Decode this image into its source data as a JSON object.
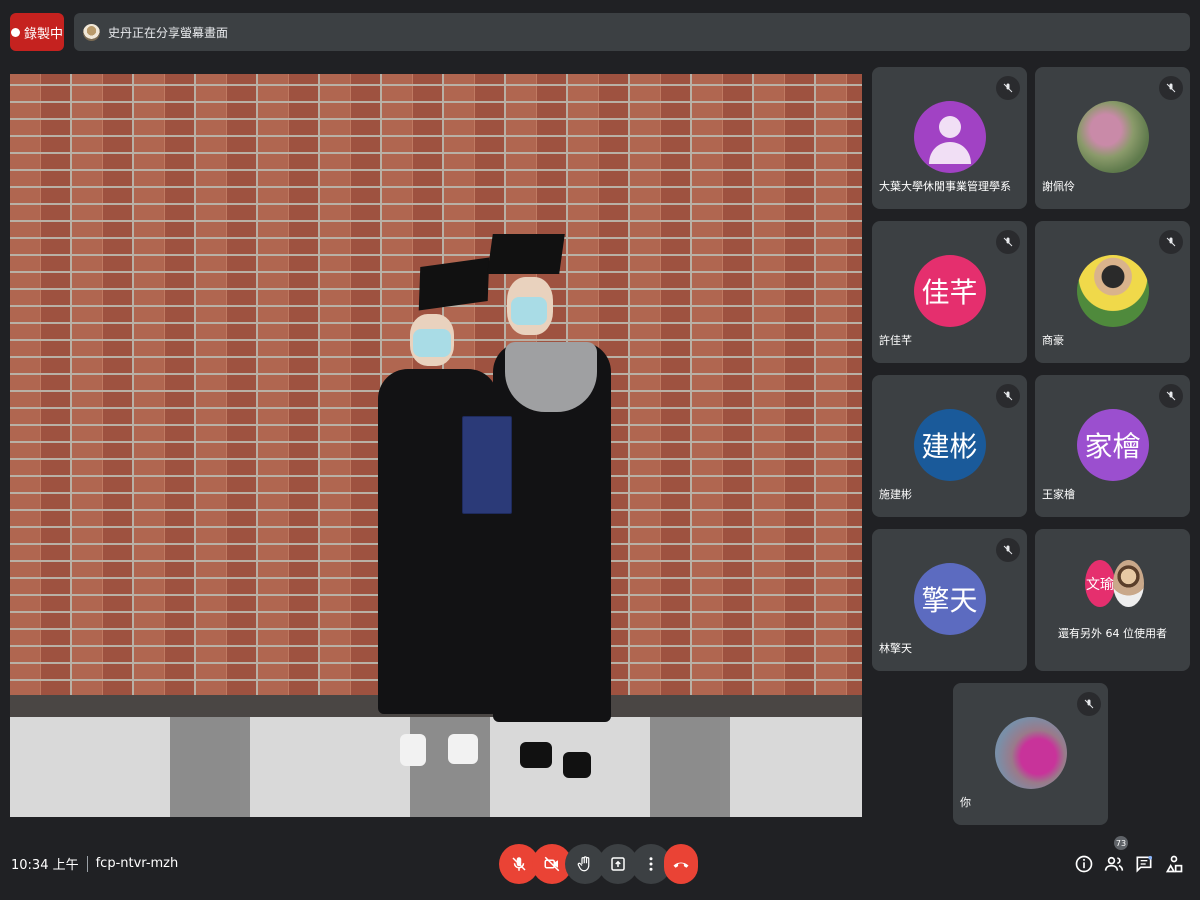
{
  "top_bar": {
    "recording_label": "錄製中",
    "presenting_text": "史丹正在分享螢幕畫面"
  },
  "participants": [
    {
      "name": "大葉大學休閒事業管理學系",
      "avatar_type": "silhouette",
      "avatar_color": "#a142c4",
      "muted": true
    },
    {
      "name": "謝佩伶",
      "avatar_type": "photo",
      "muted": true
    },
    {
      "name": "許佳芊",
      "avatar_text": "佳芊",
      "avatar_color": "#e52f6e",
      "muted": true
    },
    {
      "name": "商豪",
      "avatar_type": "photo",
      "muted": true
    },
    {
      "name": "施建彬",
      "avatar_text": "建彬",
      "avatar_color": "#1a5a9a",
      "muted": true
    },
    {
      "name": "王家檜",
      "avatar_text": "家檜",
      "avatar_color": "#9b4fcf",
      "muted": true
    },
    {
      "name": "林擎天",
      "avatar_text": "擎天",
      "avatar_color": "#5c6bc0",
      "muted": true
    }
  ],
  "overflow_tile": {
    "avatar_text": "文瑜",
    "avatar_color": "#e52f6e",
    "label": "還有另外 64 位使用者"
  },
  "self_tile": {
    "name": "你",
    "avatar_type": "photo",
    "muted": true
  },
  "bottom_bar": {
    "time": "10:34 上午",
    "meeting_code": "fcp-ntvr-mzh",
    "people_count": "73"
  },
  "controls": {
    "icons": [
      "mic-off-icon",
      "camera-off-icon",
      "raise-hand-icon",
      "present-icon",
      "more-options-icon",
      "end-call-icon"
    ],
    "right_icons": [
      "info-icon",
      "people-icon",
      "chat-icon",
      "activities-icon"
    ]
  },
  "colors": {
    "background": "#202124",
    "tile": "#3c4043",
    "danger": "#ea4335",
    "recording": "#c5221f"
  }
}
